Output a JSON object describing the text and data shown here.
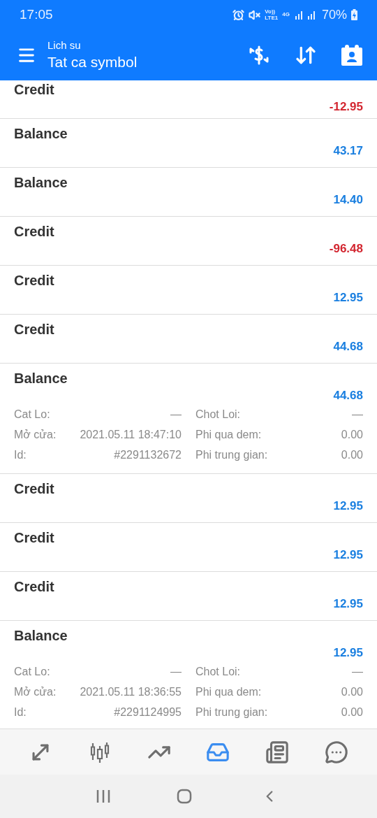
{
  "status_bar": {
    "time": "17:05",
    "network_labels": [
      "Vo))",
      "LTE1"
    ],
    "data_label": "4G",
    "battery": "70%"
  },
  "header": {
    "subtitle": "Lich su",
    "title": "Tat ca symbol"
  },
  "entries": [
    {
      "title": "Credit",
      "amount": "-12.95",
      "color": "#d32630"
    },
    {
      "title": "Balance",
      "amount": "43.17",
      "color": "#1a7fe0"
    },
    {
      "title": "Balance",
      "amount": "14.40",
      "color": "#1a7fe0"
    },
    {
      "title": "Credit",
      "amount": "-96.48",
      "color": "#d32630"
    },
    {
      "title": "Credit",
      "amount": "12.95",
      "color": "#1a7fe0"
    },
    {
      "title": "Credit",
      "amount": "44.68",
      "color": "#1a7fe0"
    },
    {
      "title": "Balance",
      "amount": "44.68",
      "color": "#1a7fe0",
      "details": [
        {
          "label": "Cat Lo:",
          "value": "—"
        },
        {
          "label": "Chot Loi:",
          "value": "—"
        },
        {
          "label": "Mở cửa:",
          "value": "2021.05.11 18:47:10"
        },
        {
          "label": "Phi qua dem:",
          "value": "0.00"
        },
        {
          "label": "Id:",
          "value": "#2291132672"
        },
        {
          "label": "Phi trung gian:",
          "value": "0.00"
        }
      ]
    },
    {
      "title": "Credit",
      "amount": "12.95",
      "color": "#1a7fe0"
    },
    {
      "title": "Credit",
      "amount": "12.95",
      "color": "#1a7fe0"
    },
    {
      "title": "Credit",
      "amount": "12.95",
      "color": "#1a7fe0"
    },
    {
      "title": "Balance",
      "amount": "12.95",
      "color": "#1a7fe0",
      "details": [
        {
          "label": "Cat Lo:",
          "value": "—"
        },
        {
          "label": "Chot Loi:",
          "value": "—"
        },
        {
          "label": "Mở cửa:",
          "value": "2021.05.11 18:36:55"
        },
        {
          "label": "Phi qua dem:",
          "value": "0.00"
        },
        {
          "label": "Id:",
          "value": "#2291124995"
        },
        {
          "label": "Phi trung gian:",
          "value": "0.00"
        }
      ]
    }
  ],
  "bottom_nav": [
    {
      "kind": "quotes",
      "selected": false
    },
    {
      "kind": "chart",
      "selected": false
    },
    {
      "kind": "trade",
      "selected": false
    },
    {
      "kind": "history",
      "selected": true
    },
    {
      "kind": "news",
      "selected": false
    },
    {
      "kind": "chat",
      "selected": false
    }
  ]
}
